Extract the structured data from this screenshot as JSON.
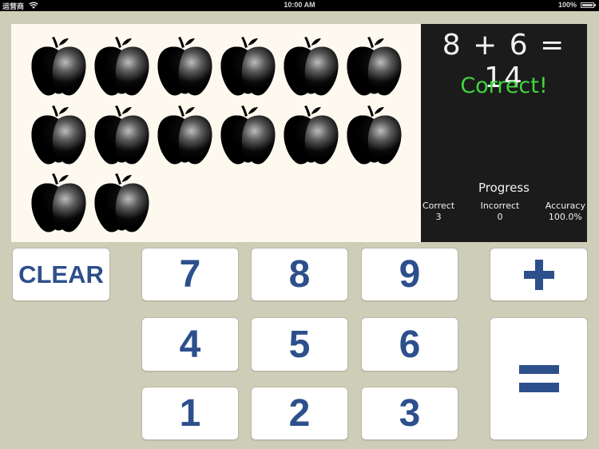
{
  "status_bar": {
    "carrier": "运营商",
    "time": "10:00 AM",
    "battery": "100%"
  },
  "apples": {
    "count": 14,
    "per_row": 6
  },
  "board": {
    "equation": "8 + 6 = 14",
    "feedback": "Correct!",
    "feedback_color": "#3fd63f",
    "progress_title": "Progress",
    "stats": [
      {
        "label": "Correct",
        "value": "3"
      },
      {
        "label": "Incorrect",
        "value": "0"
      },
      {
        "label": "Accuracy",
        "value": "100.0%"
      }
    ]
  },
  "keypad": {
    "clear_label": "CLEAR",
    "digits": [
      "7",
      "8",
      "9",
      "4",
      "5",
      "6",
      "1",
      "2",
      "3"
    ],
    "plus_icon": "plus-icon",
    "equals_icon": "equals-icon",
    "text_color": "#2d4f8c"
  }
}
